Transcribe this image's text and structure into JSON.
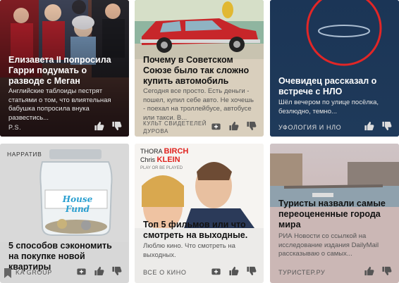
{
  "cards": [
    {
      "title": "Елизавета II попросила Гарри подумать о разводе с Меган",
      "snippet": "Английские таблоиды пестрят статьями о том, что влиятельная бабушка попросила внука развестись...",
      "source": "P.S."
    },
    {
      "title": "Почему в Советском Союзе было так сложно купить автомобиль",
      "snippet": "Сегодня все просто. Есть деньги - пошел, купил себе авто. Не хочешь - поехал на троллейбусе, автобусе или такси. В...",
      "source": "КУЛЬТ СВИДЕТЕЛЕЙ ДУРОВА"
    },
    {
      "title": "Очевидец рассказал о встрече с НЛО",
      "snippet": "Шёл вечером по улице посёлка, безлюдно, темно...",
      "source": "УФОЛОГИЯ И НЛО"
    },
    {
      "tag": "НАРРАТИВ",
      "jar_label": "House Fund",
      "title": "5 способов сэкономить на покупке новой квартиры",
      "source": "KA GROUP"
    },
    {
      "poster": {
        "actor1": "THORA",
        "actor1_last": "BIRCH",
        "actor2": "Chris",
        "actor2_last": "KLEIN",
        "subtitle": "PLAY OR BE PLAYED"
      },
      "title": "Топ 5 фильмов или что смотреть на выходные.",
      "snippet": "Люблю кино. Что смотреть на выходных.",
      "source": "ВСЕ О КИНО"
    },
    {
      "title": "Туристы назвали самые переоцененные города мира",
      "snippet": "РИА Новости со ссылкой на исследование издания DailyMail рассказываю о самых...",
      "source": "ТУРИСТЕР.РУ"
    }
  ],
  "colors": {
    "royal_bg": "#2a1a1c",
    "car_bg": "#d8cdb9",
    "car_red": "#c7262a",
    "ufo_bg": "#1d3a5c",
    "ufo_circle": "#e22626",
    "grey_card": "#d7d7d7",
    "movie_bg": "#ecebe9",
    "paris_bg": "#cbb7b5"
  },
  "icons": [
    "thumb-up-icon",
    "thumb-down-icon",
    "add-to-feed-icon",
    "bookmark-icon"
  ]
}
